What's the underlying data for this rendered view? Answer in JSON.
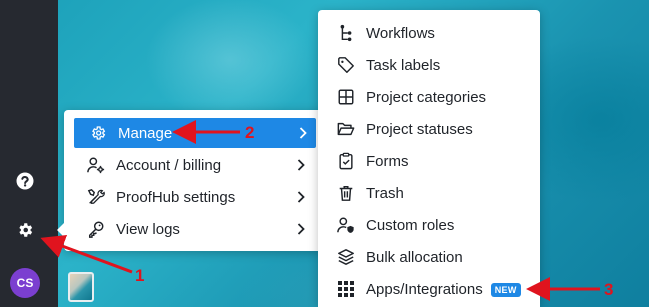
{
  "sidebar": {
    "help_icon": "help-circle-icon",
    "settings_icon": "gear-icon",
    "avatar_initials": "CS",
    "avatar_color": "#7b3fd0"
  },
  "manage_menu": {
    "items": [
      {
        "label": "Manage",
        "icon": "gear-icon",
        "active": true
      },
      {
        "label": "Account / billing",
        "icon": "user-settings-icon"
      },
      {
        "label": "ProofHub settings",
        "icon": "tools-icon"
      },
      {
        "label": "View logs",
        "icon": "key-icon"
      }
    ]
  },
  "submenu": {
    "items": [
      {
        "label": "Workflows",
        "icon": "workflow-icon"
      },
      {
        "label": "Task labels",
        "icon": "tag-icon"
      },
      {
        "label": "Project categories",
        "icon": "grid-icon"
      },
      {
        "label": "Project statuses",
        "icon": "folder-open-icon"
      },
      {
        "label": "Forms",
        "icon": "clipboard-check-icon"
      },
      {
        "label": "Trash",
        "icon": "trash-icon"
      },
      {
        "label": "Custom roles",
        "icon": "user-shield-icon"
      },
      {
        "label": "Bulk allocation",
        "icon": "layers-icon"
      },
      {
        "label": "Apps/Integrations",
        "icon": "apps-grid-icon",
        "badge": "NEW"
      }
    ]
  },
  "annotations": {
    "one": "1",
    "two": "2",
    "three": "3"
  },
  "colors": {
    "accent": "#1e88e5",
    "sidebar_bg": "#262930",
    "annotation_red": "#e0141e"
  }
}
